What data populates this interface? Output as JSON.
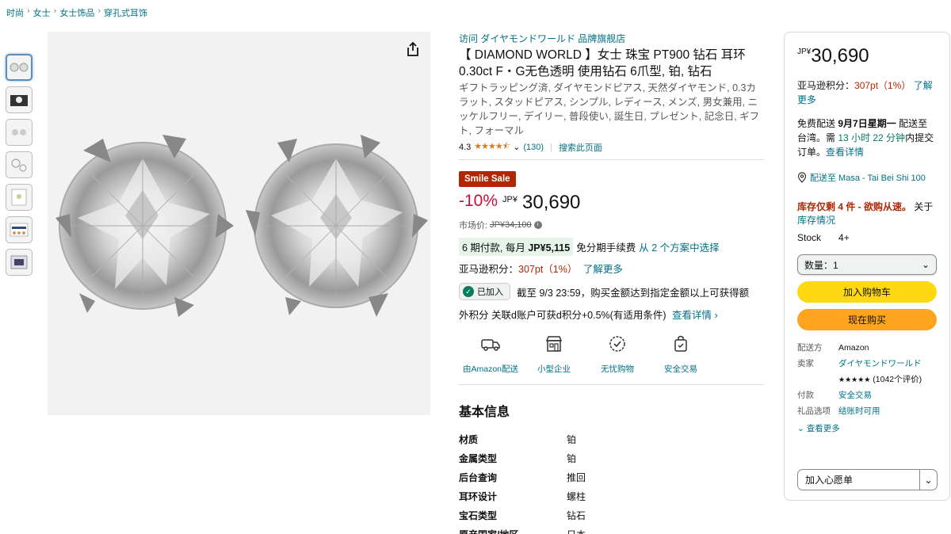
{
  "breadcrumb": [
    "时尚",
    "女士",
    "女士饰品",
    "穿孔式耳饰"
  ],
  "product": {
    "store_link": "访问 ダイヤモンドワールド 品牌旗舰店",
    "title": "【 DIAMOND WORLD 】女士 珠宝 PT900 钻石 耳环 0.30ct F・G无色透明 使用钻石 6爪型, 铂, 钻石",
    "subtitle": "ギフトラッピング済, ダイヤモンドピアス, 天然ダイヤモンド, 0.3カラット, スタッドピアス, シンプル, レディース, メンズ, 男女兼用, ニッケルフリー, デイリー, 普段使い, 誕生日, プレゼント, 記念日, ギフト, フォーマル",
    "rating": "4.3",
    "rating_value": 4.3,
    "review_count": "(130)",
    "search_page": "搜索此页面",
    "badge": "Smile Sale",
    "discount": "-10%",
    "currency": "JP¥",
    "price": "30,690",
    "list_price_label": "市场价:",
    "list_price": "JP¥34,100",
    "installment_a": "6 期付款, 每月",
    "installment_amount": "JP¥5,115",
    "installment_b": "免分期手续费",
    "installment_link": "从 2 个方案中选择",
    "points_label": "亚马逊积分：",
    "points_value": "307pt（1%）",
    "points_link": "了解更多",
    "joined": "已加入",
    "joined_text": "截至 9/3 23:59，购买金额达到指定金额以上可获得额",
    "dpoints_text": "外积分 关联d账户可获d积分+0.5%(有适用条件)",
    "dpoints_link": "查看详情 ›"
  },
  "features": [
    {
      "icon": "truck-icon",
      "label": "由Amazon配送"
    },
    {
      "icon": "shop-icon",
      "label": "小型企业"
    },
    {
      "icon": "badge-check-icon",
      "label": "无忧购物"
    },
    {
      "icon": "secure-bag-icon",
      "label": "安全交易"
    }
  ],
  "specs": {
    "title": "基本信息",
    "rows": [
      {
        "key": "材质",
        "value": "铂"
      },
      {
        "key": "金属类型",
        "value": "铂"
      },
      {
        "key": "后台查询",
        "value": "推回"
      },
      {
        "key": "耳环设计",
        "value": "螺柱"
      },
      {
        "key": "宝石类型",
        "value": "钻石"
      },
      {
        "key": "原产国家/地区",
        "value": "日本"
      }
    ]
  },
  "buybox": {
    "currency": "JP¥",
    "price": "30,690",
    "points_label": "亚马逊积分：",
    "points_value": "307pt（1%）",
    "points_link": "了解更多",
    "ship_a": "免费配送",
    "ship_date": "9月7日星期一",
    "ship_b": "配送至台湾。需",
    "ship_time": "13 小时 22 分钟",
    "ship_c": "内提交订单。",
    "ship_link": "查看详情",
    "location": "配送至 Masa - Tai Bei Shi 100",
    "stock_warning": "库存仅剩 4 件 - 欲购从速。",
    "stock_about": "关于",
    "stock_link": "库存情况",
    "stock_label": "Stock",
    "stock_value": "4+",
    "qty_label": "数量：",
    "qty_value": "1",
    "add_to_cart": "加入购物车",
    "buy_now": "现在购买",
    "ships_from_label": "配送方",
    "ships_from": "Amazon",
    "seller_label": "卖家",
    "seller": "ダイヤモンドワールド",
    "seller_reviews": "(1042个评价)",
    "payment_label": "付款",
    "payment": "安全交易",
    "gift_label": "礼品选项",
    "gift": "结账时可用",
    "see_more": "查看更多",
    "wishlist": "加入心愿单"
  },
  "colors": {
    "link": "#007185",
    "price_red": "#cc0c39",
    "badge": "#b12704",
    "cart_button": "#ffd814",
    "buy_button": "#ffa41c"
  }
}
